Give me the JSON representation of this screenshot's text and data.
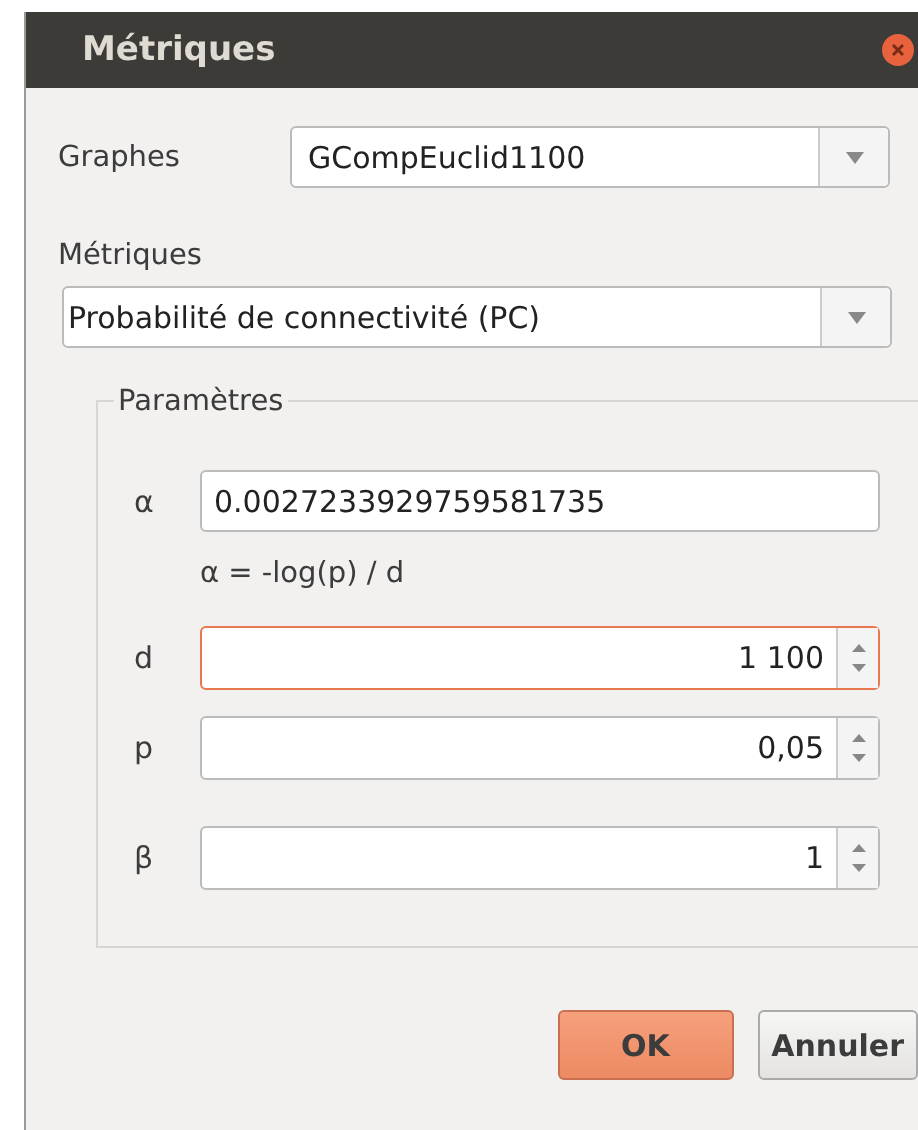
{
  "window": {
    "title": "Métriques"
  },
  "graph": {
    "label": "Graphes",
    "value": "GCompEuclid1100"
  },
  "metric": {
    "label": "Métriques",
    "value": "Probabilité de connectivité (PC)"
  },
  "parameters": {
    "title": "Paramètres",
    "alpha": {
      "label": "α",
      "value": "0.0027233929759581735",
      "formula": "α = -log(p) / d"
    },
    "spins": [
      {
        "label": "d",
        "value": "1 100",
        "focused": true
      },
      {
        "label": "p",
        "value": "0,05",
        "focused": false
      },
      {
        "label": "β",
        "value": "1",
        "focused": false
      }
    ]
  },
  "buttons": [
    {
      "label": "OK",
      "kind": "default"
    },
    {
      "label": "Annuler",
      "kind": "normal"
    }
  ]
}
